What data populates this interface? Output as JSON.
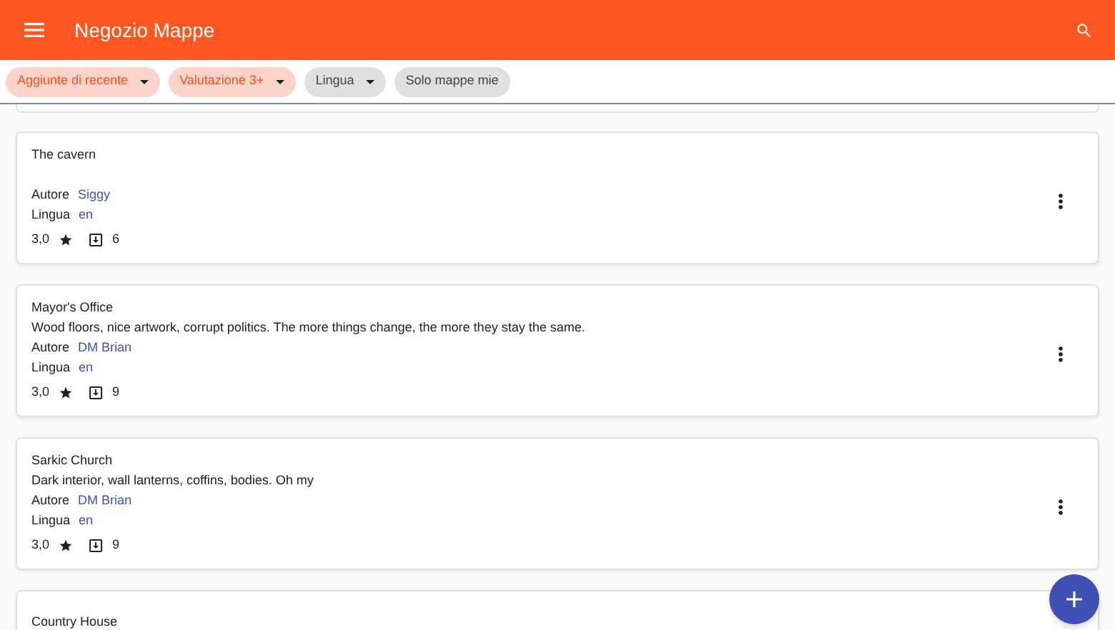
{
  "app_bar": {
    "title": "Negozio Mappe"
  },
  "filters": [
    {
      "label": "Aggiunte di recente",
      "selected": true,
      "kind": "dropdown"
    },
    {
      "label": "Valutazione 3+",
      "selected": true,
      "kind": "dropdown"
    },
    {
      "label": "Lingua",
      "selected": false,
      "kind": "dropdown"
    },
    {
      "label": "Solo mappe mie",
      "selected": false,
      "kind": "toggle"
    }
  ],
  "maps": [
    {
      "title": "The cavern",
      "author_label": "Autore",
      "author": "Siggy",
      "language_label": "Lingua",
      "language": "en",
      "rating": "3,0",
      "downloads": "6"
    },
    {
      "title": "Mayor's Office",
      "description": "Wood floors, nice artwork, corrupt politics. The more things change, the more they stay the same.",
      "author_label": "Autore",
      "author": "DM Brian",
      "language_label": "Lingua",
      "language": "en",
      "rating": "3,0",
      "downloads": "9"
    },
    {
      "title": "Sarkic Church",
      "description": "Dark interior, wall lanterns, coffins, bodies. Oh my",
      "author_label": "Autore",
      "author": "DM Brian",
      "language_label": "Lingua",
      "language": "en",
      "rating": "3,0",
      "downloads": "9"
    },
    {
      "title": "Country House"
    }
  ]
}
